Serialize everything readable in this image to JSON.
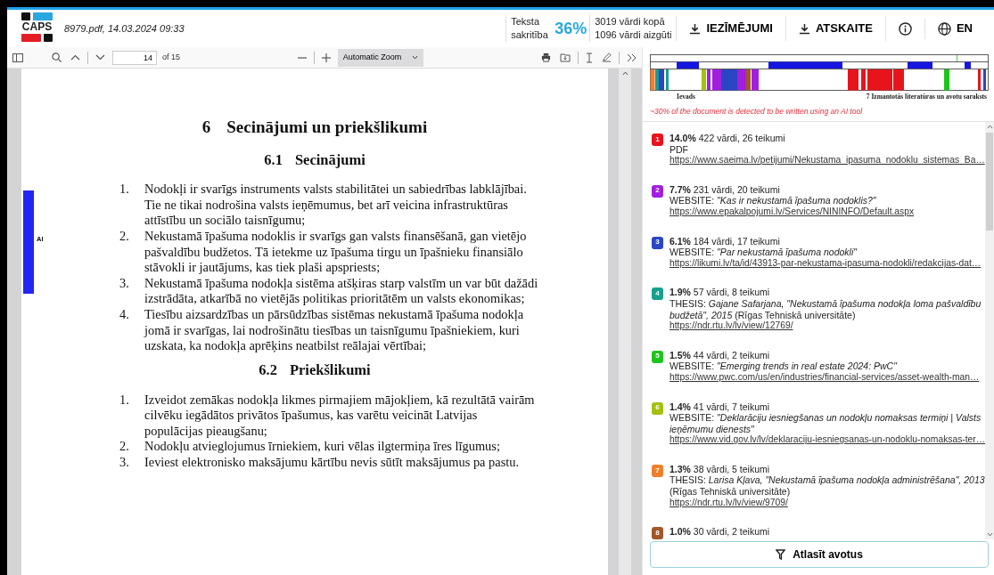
{
  "header": {
    "logo_text": "CAPS",
    "file_info": "8979.pdf, 14.03.2024 09:33",
    "similarity_label": "Teksta sakritība",
    "similarity": "36%",
    "words_total": "3019 vārdi kopā",
    "words_borrowed": "1096 vārdi aizgūti",
    "buttons": [
      {
        "label": "IEZĪMĒJUMI"
      },
      {
        "label": "ATSKAITE"
      }
    ],
    "language": "EN"
  },
  "viewer_toolbar": {
    "page": "14",
    "page_count": "of 15",
    "zoom": "Automatic Zoom"
  },
  "document": {
    "ai_marker": "AI",
    "heading_number": "6",
    "heading": "Secinājumi un priekšlikumi",
    "sections": [
      {
        "number": "6.1",
        "title": "Secinājumi",
        "items": [
          {
            "number": "1.",
            "text": "Nodokļi ir svarīgs instruments valsts stabilitātei un sabiedrības labklājībai. Tie ne tikai nodrošina valsts ieņēmumus, bet arī veicina infrastruktūras attīstību un sociālo taisnīgumu;"
          },
          {
            "number": "2.",
            "text": "Nekustamā īpašuma nodoklis ir svarīgs gan valsts finansēšanā, gan vietējo pašvaldību budžetos. Tā ietekme uz īpašuma tirgu un īpašnieku finansiālo stāvokli ir jautājums, kas tiek plaši apspriests;"
          },
          {
            "number": "3.",
            "text": "Nekustamā īpašuma nodokļa sistēma atšķiras starp valstīm un var būt dažādi izstrādāta, atkarībā no vietējās politikas prioritātēm un valsts ekonomikas;"
          },
          {
            "number": "4.",
            "text": "Tiesību aizsardzības un pārsūdzības sistēmas nekustamā īpašuma nodokļa jomā ir svarīgas, lai nodrošinātu tiesības un taisnīgumu īpašniekiem, kuri uzskata, ka nodokļa aprēķins neatbilst reālajai vērtībai;"
          }
        ]
      },
      {
        "number": "6.2",
        "title": "Priekšlikumi",
        "items": [
          {
            "number": "1.",
            "text": "Izveidot zemākas nodokļa likmes pirmajiem mājokļiem, kā rezultātā vairām cilvēku iegādātos privātos īpašumus, kas varētu veicināt Latvijas populācijas pieaugšanu;"
          },
          {
            "number": "2.",
            "text": "Nodokļu atvieglojumus īrniekiem, kuri vēlas ilgtermiņa īres līgumus;"
          },
          {
            "number": "3.",
            "text": "Ieviest elektronisko maksājumu kārtību nevis sūtīt maksājumus pa pastu."
          }
        ]
      }
    ]
  },
  "document_map": {
    "labels": [
      "Ievads",
      "7 Izmantotās literatūras un avotu saraksts"
    ],
    "ai_notice": "~30% of the document is detected to be written using an AI tool"
  },
  "sources": [
    {
      "number": "1",
      "color": "#e8141c",
      "summary": "**14.0%** 422 vārdi, 26 teikumi",
      "source": "PDF",
      "url": "https://www.saeima.lv/petijumi/Nekustama_ipasuma_nodoklu_sistemas_Ba…"
    },
    {
      "number": "2",
      "color": "#a21fe0",
      "summary": "**7.7%** 231 vārdi, 20 teikumi",
      "source": "WEBSITE: *\"Kas ir nekustamā īpašuma nodoklis?\"*",
      "url": "https://www.epakalpojumi.lv/Services/NININFO/Default.aspx"
    },
    {
      "number": "3",
      "color": "#2a46c4",
      "summary": "**6.1%** 184 vārdi, 17 teikumi",
      "source": "WEBSITE: *\"Par nekustamā īpašuma nodokli\"*",
      "url": "https://likumi.lv/ta/id/43913-par-nekustama-ipasuma-nodokli/redakcijas-dat…"
    },
    {
      "number": "4",
      "color": "#16a08e",
      "summary": "**1.9%** 57 vārdi, 8 teikumi",
      "source": "THESIS: *Gajane Safarjana, \"Nekustamā īpašuma nodokļa loma pašvaldību budžetā\", 2015* (Rīgas Tehniskā universitāte)",
      "url": "https://ndr.rtu.lv/lv/view/12769/"
    },
    {
      "number": "5",
      "color": "#1ec41e",
      "summary": "**1.5%** 44 vārdi, 2 teikumi",
      "source": "WEBSITE: *\"Emerging trends in real estate 2024: PwC\"*",
      "url": "https://www.pwc.com/us/en/industries/financial-services/asset-wealth-man…"
    },
    {
      "number": "6",
      "color": "#a6bf12",
      "summary": "**1.4%** 41 vārdi, 7 teikumi",
      "source": "WEBSITE: *\"Deklarāciju iesniegšanas un nodokļu nomaksas termiņi | Valsts ieņēmumu dienests\"*",
      "url": "https://www.vid.gov.lv/lv/deklaraciju-iesniegsanas-un-nodoklu-nomaksas-ter…"
    },
    {
      "number": "7",
      "color": "#f07f2c",
      "summary": "**1.3%** 38 vārdi, 5 teikumi",
      "source": "THESIS: *Larisa Kļava, \"Nekustamā īpašuma nodokļa administrēšana\", 2013* (Rīgas Tehniskā universitāte)",
      "url": "https://ndr.rtu.lv/lv/view/9709/"
    },
    {
      "number": "8",
      "color": "#a0582a",
      "summary": "**1.0%** 30 vārdi, 2 teikumi"
    }
  ],
  "filter_button": "Atlasīt avotus"
}
